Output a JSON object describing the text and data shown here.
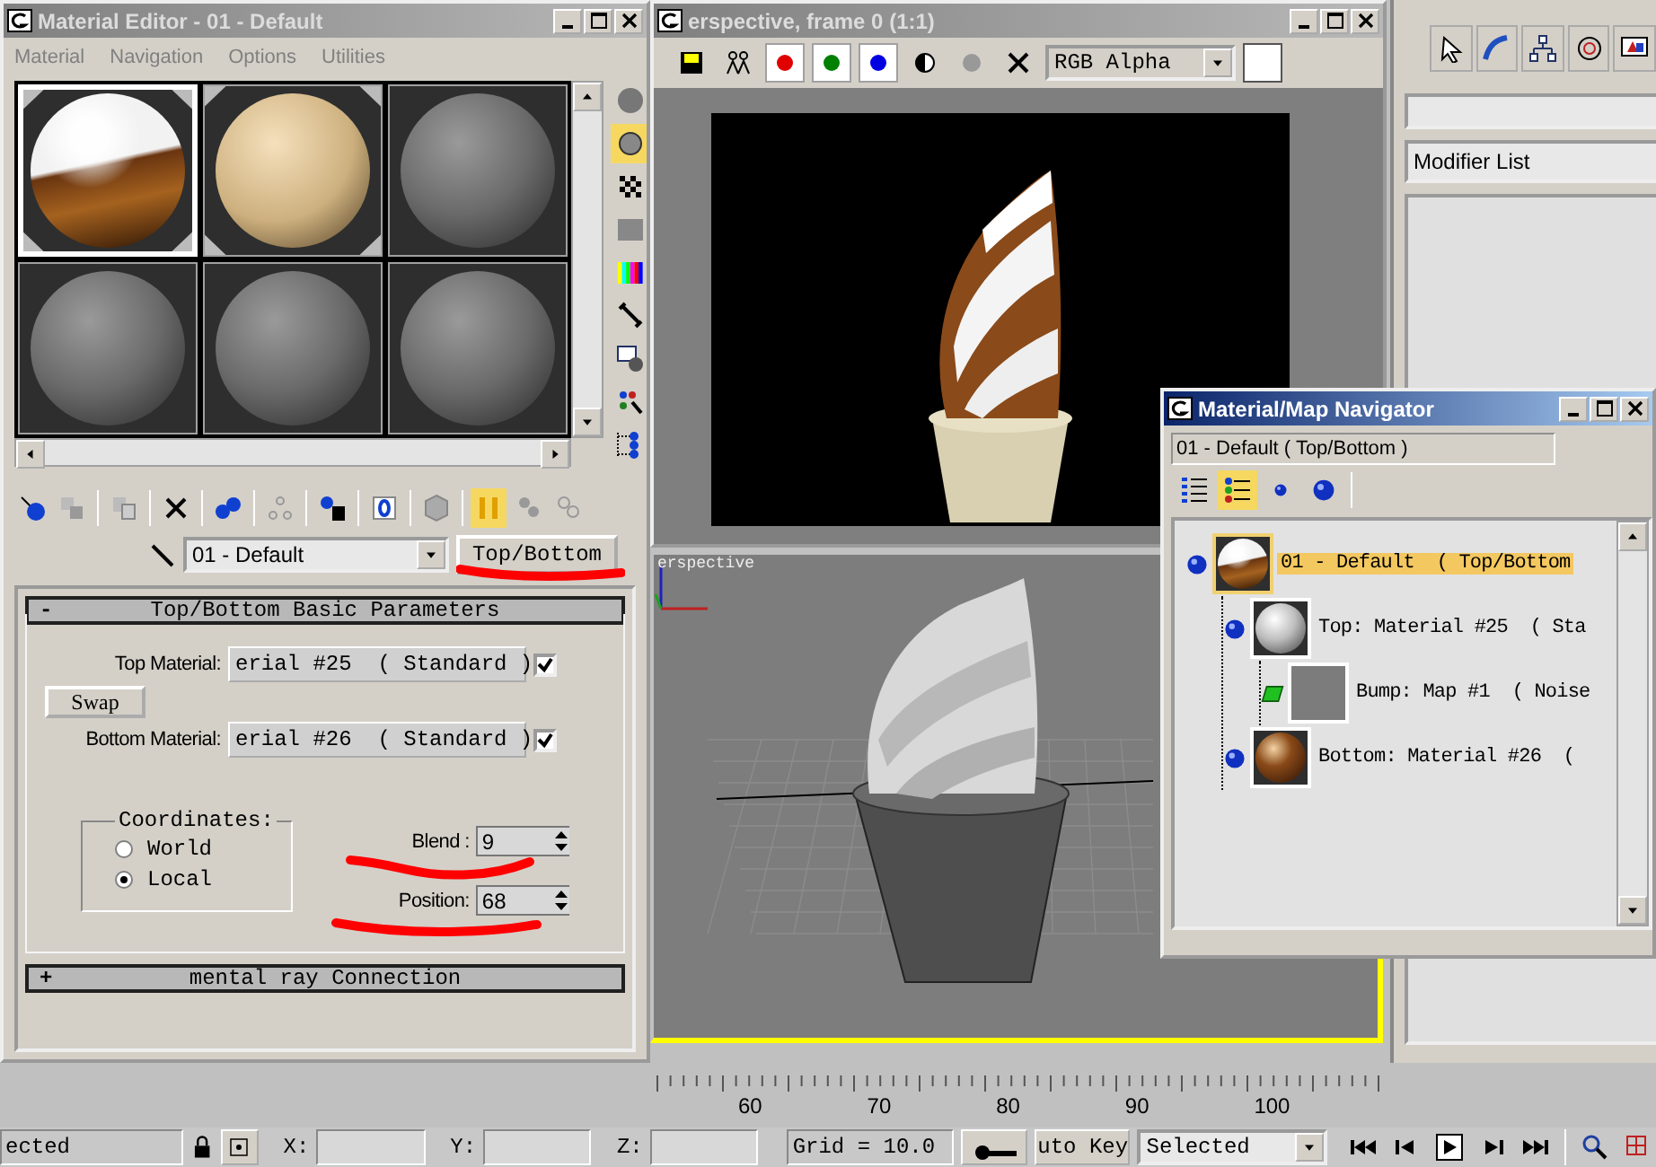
{
  "material_editor": {
    "title": "Material Editor - 01 - Default",
    "menu": [
      "Material",
      "Navigation",
      "Options",
      "Utilities"
    ],
    "slots": [
      {
        "kind": "top_bottom",
        "selected": true,
        "hot": true
      },
      {
        "kind": "cream",
        "selected": false,
        "hot": true
      },
      {
        "kind": "gray",
        "selected": false,
        "hot": false
      },
      {
        "kind": "gray",
        "selected": false,
        "hot": false
      },
      {
        "kind": "gray",
        "selected": false,
        "hot": false
      },
      {
        "kind": "gray",
        "selected": false,
        "hot": false
      }
    ],
    "material_name": "01 - Default",
    "type_button": "Top/Bottom",
    "rollouts": [
      {
        "sign": "-",
        "title": "Top/Bottom Basic Parameters"
      },
      {
        "sign": "+",
        "title": "mental ray Connection"
      }
    ],
    "top_material": {
      "label": "Top Material:",
      "value": "erial #25  ( Standard )",
      "checked": true
    },
    "swap": "Swap",
    "bottom_material": {
      "label": "Bottom Material:",
      "value": "erial #26  ( Standard )",
      "checked": true
    },
    "coordinates": {
      "title": "Coordinates:",
      "options": [
        {
          "label": "World",
          "selected": false
        },
        {
          "label": "Local",
          "selected": true
        }
      ]
    },
    "blend": {
      "label": "Blend :",
      "value": "9"
    },
    "position": {
      "label": "Position:",
      "value": "68"
    }
  },
  "frame_window": {
    "title": "erspective, frame 0 (1:1)",
    "channel": "RGB Alpha"
  },
  "viewport": {
    "label": "erspective"
  },
  "command_panel": {
    "modifier_list": "Modifier List"
  },
  "navigator": {
    "title": "Material/Map Navigator",
    "path": "01 - Default ( Top/Bottom )",
    "tree": [
      {
        "label": "01 - Default  ( Top/Bottom",
        "kind": "material",
        "thumb": {
          "kind": "top_bottom"
        },
        "selected": true,
        "children": [
          {
            "label": "Top: Material #25  ( Sta",
            "kind": "material",
            "thumb": {
              "kind": "white"
            },
            "selected": false,
            "children": [
              {
                "label": "Bump: Map #1  ( Noise",
                "kind": "map",
                "thumb": {
                  "kind": "noise"
                },
                "selected": false
              }
            ]
          },
          {
            "label": "Bottom: Material #26  (",
            "kind": "material",
            "thumb": {
              "kind": "brown"
            },
            "selected": false
          }
        ]
      }
    ]
  },
  "timeline": {
    "ticks": [
      "60",
      "70",
      "80",
      "90",
      "100"
    ]
  },
  "status_bar": {
    "selection": "ected",
    "x_label": "X:",
    "y_label": "Y:",
    "z_label": "Z:",
    "grid": "Grid = 10.0",
    "auto_key": "uto Key",
    "key_mode": "Selected"
  }
}
